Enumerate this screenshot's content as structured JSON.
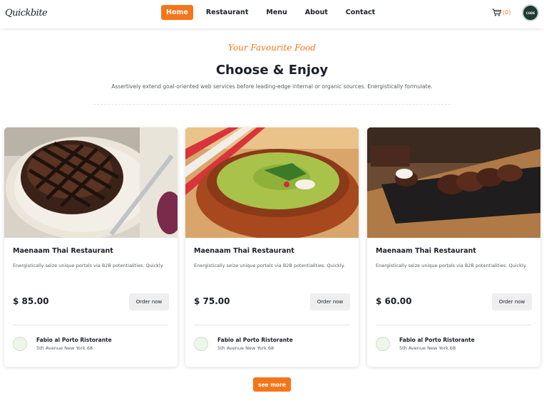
{
  "header": {
    "logo_text": "Quickbite",
    "nav": [
      "Home",
      "Restaurant",
      "Menu",
      "About",
      "Contact"
    ],
    "active_nav": "Home",
    "cart_count": "(0)",
    "avatar_label": "CODE"
  },
  "section": {
    "subtitle": "Your Favourite Food",
    "title": "Choose & Enjoy",
    "description": "Assertively extend goal-oriented web services before leading-edge internal or organic sources. Energistically formulate."
  },
  "cards": [
    {
      "title": "Maenaam Thai Restaurant",
      "description": "Energistically seize unique portals via B2B potentialities. Quickly.",
      "price": "$ 85.00",
      "order_label": "Order now",
      "venue_name": "Fabio al Porto Ristorante",
      "venue_address": "5th Avenue New York 68"
    },
    {
      "title": "Maenaam Thai Restaurant",
      "description": "Energistically seize unique portals via B2B potentialities. Quickly.",
      "price": "$ 75.00",
      "order_label": "Order now",
      "venue_name": "Fabio al Porto Ristorante",
      "venue_address": "5th Avenue New York 68"
    },
    {
      "title": "Maenaam Thai Restaurant",
      "description": "Energistically seize unique portals via B2B potentialities. Quickly.",
      "price": "$ 60.00",
      "order_label": "Order now",
      "venue_name": "Fabio al Porto Ristorante",
      "venue_address": "5th Avenue New York 68"
    }
  ],
  "see_more_label": "see more",
  "colors": {
    "accent": "#f5761a",
    "text": "#1b1f2a",
    "muted": "#555c66"
  }
}
